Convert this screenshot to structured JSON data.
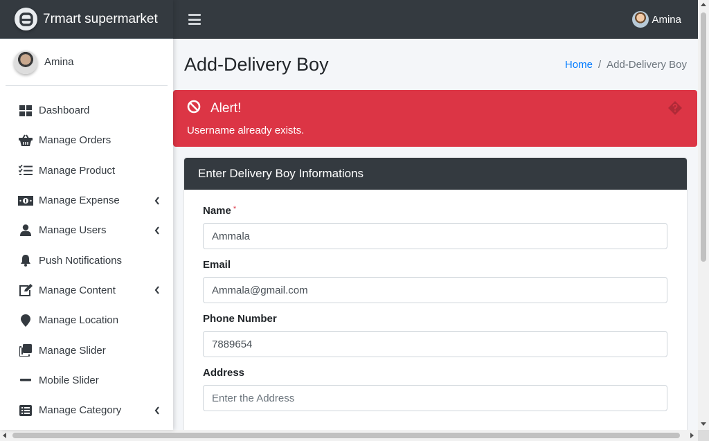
{
  "brand": {
    "name": "7rmart supermarket",
    "logo_icon": "brand-logo-icon"
  },
  "sidebar": {
    "user_name": "Amina",
    "items": [
      {
        "label": "Dashboard",
        "icon": "dashboard-icon",
        "has_caret": false
      },
      {
        "label": "Manage Orders",
        "icon": "basket-icon",
        "has_caret": false
      },
      {
        "label": "Manage Product",
        "icon": "tasks-icon",
        "has_caret": false
      },
      {
        "label": "Manage Expense",
        "icon": "money-bill-icon",
        "has_caret": true
      },
      {
        "label": "Manage Users",
        "icon": "user-icon",
        "has_caret": true
      },
      {
        "label": "Push Notifications",
        "icon": "bell-icon",
        "has_caret": false
      },
      {
        "label": "Manage Content",
        "icon": "edit-icon",
        "has_caret": true
      },
      {
        "label": "Manage Location",
        "icon": "map-marker-icon",
        "has_caret": false
      },
      {
        "label": "Manage Slider",
        "icon": "clone-icon",
        "has_caret": false
      },
      {
        "label": "Mobile Slider",
        "icon": "minus-icon",
        "has_caret": false
      },
      {
        "label": "Manage Category",
        "icon": "list-alt-icon",
        "has_caret": true
      }
    ]
  },
  "topbar": {
    "user_name": "Amina"
  },
  "header": {
    "title": "Add-Delivery Boy",
    "breadcrumb": {
      "home": "Home",
      "current": "Add-Delivery Boy"
    }
  },
  "alert": {
    "title": "Alert!",
    "message": "Username already exists.",
    "color": "#dc3545"
  },
  "form": {
    "card_title": "Enter Delivery Boy Informations",
    "fields": [
      {
        "label": "Name",
        "required_mark": "*",
        "value": "Ammala",
        "placeholder": ""
      },
      {
        "label": "Email",
        "value": "Ammala@gmail.com",
        "placeholder": ""
      },
      {
        "label": "Phone Number",
        "value": "7889654",
        "placeholder": ""
      },
      {
        "label": "Address",
        "value": "",
        "placeholder": "Enter the Address"
      }
    ]
  },
  "colors": {
    "dark": "#343a40",
    "link": "#007bff",
    "danger": "#dc3545"
  }
}
